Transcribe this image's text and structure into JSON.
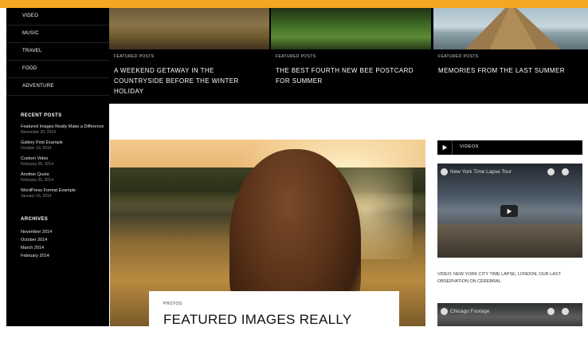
{
  "sidebar": {
    "menu": [
      "VIDEO",
      "MUSIC",
      "TRAVEL",
      "FOOD",
      "ADVENTURE"
    ],
    "recent_heading": "RECENT POSTS",
    "recent_posts": [
      {
        "title": "Featured Images Really Make a Difference",
        "date": "November 20, 2014"
      },
      {
        "title": "Gallery Post Example",
        "date": "October 19, 2014"
      },
      {
        "title": "Custom Video",
        "date": "February 28, 2014"
      },
      {
        "title": "Another Quote",
        "date": "February 25, 2014"
      },
      {
        "title": "WordPress Format Example",
        "date": "January 16, 2014"
      }
    ],
    "archives_heading": "ARCHIVES",
    "archives": [
      "November 2014",
      "October 2014",
      "March 2014",
      "February 2014"
    ]
  },
  "featured": [
    {
      "category": "FEATURED POSTS",
      "title": "A WEEKEND GETAWAY IN THE COUNTRYSIDE BEFORE THE WINTER HOLIDAY"
    },
    {
      "category": "FEATURED POSTS",
      "title": "THE BEST FOURTH NEW BEE POSTCARD FOR SUMMER"
    },
    {
      "category": "FEATURED POSTS",
      "title": "MEMORIES FROM THE LAST SUMMER"
    }
  ],
  "main_post": {
    "category": "PHOTOS",
    "title": "FEATURED IMAGES REALLY"
  },
  "videos_widget": {
    "heading": "VIDEOS",
    "video1_title": "New York Time Lapse Tour",
    "video1_caption": "VIDEO: NEW YORK CITY TIME LAPSE, LONDON, OUR LAST OBSERVATION ON CEREBRAL",
    "video2_title": "Chicago Footage"
  },
  "colors": {
    "accent": "#f5a623",
    "sidebar_bg": "#000000"
  }
}
